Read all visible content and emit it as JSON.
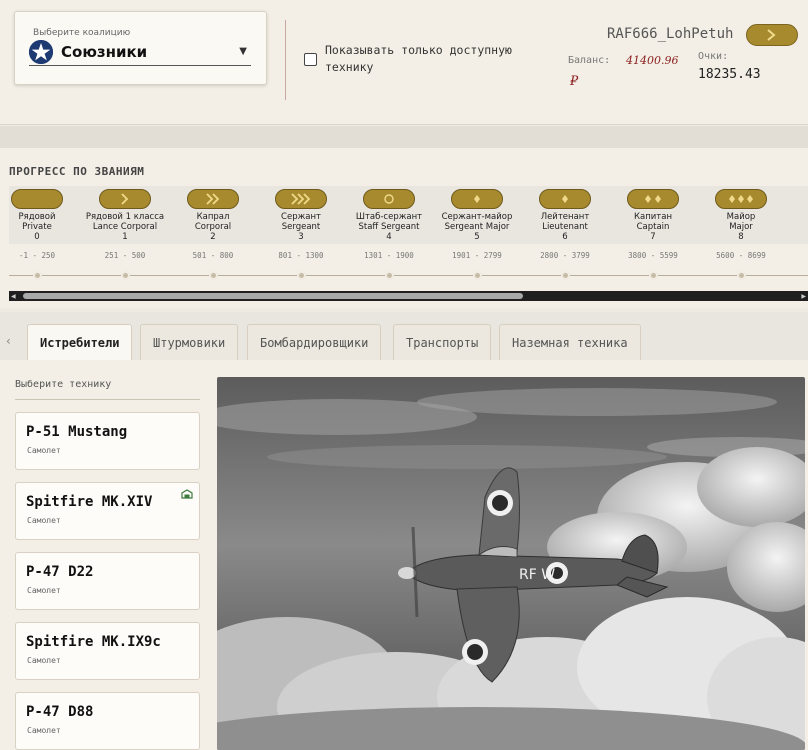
{
  "coalition": {
    "label": "Выберите коалицию",
    "value": "Союзники",
    "emblem_icon": "allied-star-icon"
  },
  "filter": {
    "label": "Показывать только доступную технику",
    "checked": false
  },
  "user": {
    "name": "RAF666_LohPetuh",
    "balance_label": "Баланс:",
    "balance_value": "41400.96",
    "currency": "₽",
    "points_label": "Очки:",
    "points_value": "18235.43"
  },
  "progress": {
    "title": "ПРОГРЕСС ПО ЗВАНИЯМ",
    "ranks": [
      {
        "ru": "Рядовой",
        "en": "Private",
        "num": "0",
        "range": "-1 - 250",
        "insignia": "blank"
      },
      {
        "ru": "Рядовой 1 класса",
        "en": "Lance Corporal",
        "num": "1",
        "range": "251 - 500",
        "insignia": "single-chevron"
      },
      {
        "ru": "Капрал",
        "en": "Corporal",
        "num": "2",
        "range": "501 - 800",
        "insignia": "double-chevron"
      },
      {
        "ru": "Сержант",
        "en": "Sergeant",
        "num": "3",
        "range": "801 - 1300",
        "insignia": "triple-chevron"
      },
      {
        "ru": "Штаб-сержант",
        "en": "Staff Sergeant",
        "num": "4",
        "range": "1301 - 1900",
        "insignia": "crest"
      },
      {
        "ru": "Сержант-майор",
        "en": "Sergeant Major",
        "num": "5",
        "range": "1901 - 2799",
        "insignia": "single-star"
      },
      {
        "ru": "Лейтенант",
        "en": "Lieutenant",
        "num": "6",
        "range": "2800 - 3799",
        "insignia": "single-star"
      },
      {
        "ru": "Капитан",
        "en": "Captain",
        "num": "7",
        "range": "3800 - 5599",
        "insignia": "double-star"
      },
      {
        "ru": "Майор",
        "en": "Major",
        "num": "8",
        "range": "5600 - 8699",
        "insignia": "triple-star"
      }
    ]
  },
  "tabs": [
    {
      "label": "Истребители",
      "active": true
    },
    {
      "label": "Штурмовики",
      "active": false
    },
    {
      "label": "Бомбардировщики",
      "active": false
    },
    {
      "label": "Транспорты",
      "active": false
    },
    {
      "label": "Наземная техника",
      "active": false
    }
  ],
  "vehicles": {
    "label": "Выберите технику",
    "items": [
      {
        "name": "P-51 Mustang",
        "type": "Самолет",
        "has_icon": false
      },
      {
        "name": "Spitfire MK.XIV",
        "type": "Самолет",
        "has_icon": true
      },
      {
        "name": "P-47 D22",
        "type": "Самолет",
        "has_icon": false
      },
      {
        "name": "Spitfire MK.IX9c",
        "type": "Самолет",
        "has_icon": false
      },
      {
        "name": "P-47 D88",
        "type": "Самолет",
        "has_icon": false
      }
    ]
  },
  "preview": {
    "image": "spitfire-in-clouds-photo",
    "aircraft_marking": "RF  W"
  },
  "colors": {
    "background": "#efebe2",
    "insignia_bar": "#a88a2e",
    "balance": "#8a1d1d"
  }
}
